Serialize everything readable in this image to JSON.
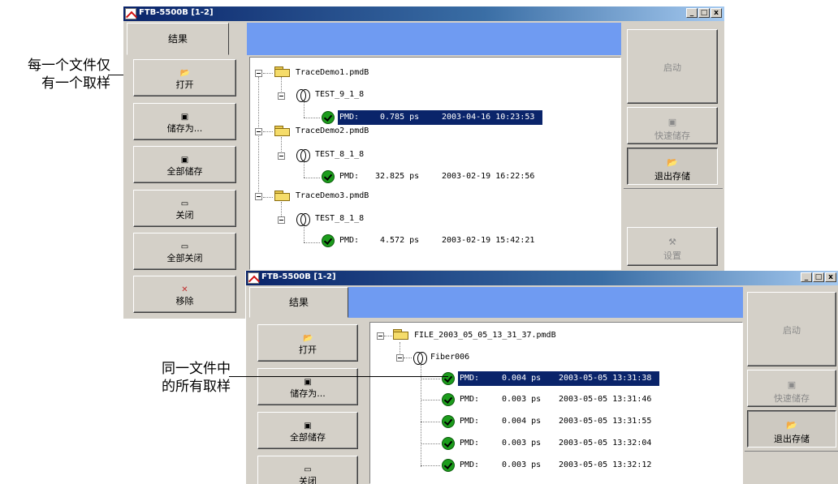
{
  "annotations": {
    "top_line1": "每一个文件仅",
    "top_line2": "有一个取样",
    "bottom_line1": "同一文件中",
    "bottom_line2": "的所有取样"
  },
  "window_back": {
    "title": "FTB-5500B [1-2]",
    "tab_label": "结果",
    "left_buttons": [
      "打开",
      "储存为...",
      "全部储存",
      "关闭",
      "全部关闭",
      "移除"
    ],
    "tree": [
      {
        "file": "TraceDemo1.pmdB",
        "fiber": "TEST_9_1_8",
        "samples": [
          {
            "label": "PMD:",
            "value": "0.785 ps",
            "time": "2003-04-16 10:23:53",
            "selected": true
          }
        ]
      },
      {
        "file": "TraceDemo2.pmdB",
        "fiber": "TEST_8_1_8",
        "samples": [
          {
            "label": "PMD:",
            "value": "32.825 ps",
            "time": "2003-02-19 16:22:56",
            "selected": false
          }
        ]
      },
      {
        "file": "TraceDemo3.pmdB",
        "fiber": "TEST_8_1_8",
        "samples": [
          {
            "label": "PMD:",
            "value": "4.572 ps",
            "time": "2003-02-19 15:42:21",
            "selected": false
          }
        ]
      }
    ],
    "right_buttons": {
      "start": "启动",
      "quick_save": "快速储存",
      "exit_save": "退出存储",
      "settings": "设置"
    }
  },
  "window_front": {
    "title": "FTB-5500B [1-2]",
    "tab_label": "结果",
    "left_buttons": [
      "打开",
      "储存为...",
      "全部储存",
      "关闭"
    ],
    "tree": {
      "file": "FILE_2003_05_05_13_31_37.pmdB",
      "fiber": "Fiber006",
      "samples": [
        {
          "label": "PMD:",
          "value": "0.004 ps",
          "time": "2003-05-05 13:31:38",
          "selected": true
        },
        {
          "label": "PMD:",
          "value": "0.003 ps",
          "time": "2003-05-05 13:31:46",
          "selected": false
        },
        {
          "label": "PMD:",
          "value": "0.004 ps",
          "time": "2003-05-05 13:31:55",
          "selected": false
        },
        {
          "label": "PMD:",
          "value": "0.003 ps",
          "time": "2003-05-05 13:32:04",
          "selected": false
        },
        {
          "label": "PMD:",
          "value": "0.003 ps",
          "time": "2003-05-05 13:32:12",
          "selected": false
        }
      ]
    },
    "right_buttons": {
      "start": "启动",
      "quick_save": "快速储存",
      "exit_save": "退出存储"
    }
  },
  "title_buttons": {
    "min": "_",
    "max": "□",
    "close": "x"
  }
}
